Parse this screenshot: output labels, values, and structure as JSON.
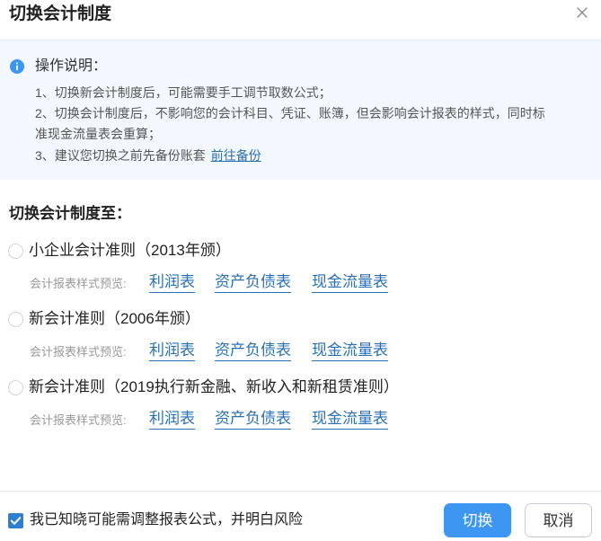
{
  "dialog": {
    "title": "切换会计制度"
  },
  "info": {
    "title": "操作说明：",
    "line1": "1、切换新会计制度后，可能需要手工调节取数公式；",
    "line2": "2、切换会计制度后，不影响您的会计科目、凭证、账簿，但会影响会计报表的样式，同时标",
    "line3": "准现金流量表会重算；",
    "line4_text": "3、建议您切换之前先备份账套",
    "line4_link": "前往备份"
  },
  "section": {
    "title": "切换会计制度至："
  },
  "options": [
    {
      "label": "小企业会计准则（2013年颁）",
      "preview_label": "会计报表样式预览:",
      "links": [
        "利润表",
        "资产负债表",
        "现金流量表"
      ]
    },
    {
      "label": "新会计准则（2006年颁）",
      "preview_label": "会计报表样式预览:",
      "links": [
        "利润表",
        "资产负债表",
        "现金流量表"
      ]
    },
    {
      "label": "新会计准则（2019执行新金融、新收入和新租赁准则）",
      "preview_label": "会计报表样式预览:",
      "links": [
        "利润表",
        "资产负债表",
        "现金流量表"
      ]
    }
  ],
  "footer": {
    "checkbox_label": "我已知晓可能需调整报表公式，并明白风险",
    "checkbox_checked": true,
    "confirm_label": "切换",
    "cancel_label": "取消"
  },
  "colors": {
    "primary": "#3d96f2",
    "link": "#2a6fb8",
    "info_bg": "#f2f8fd"
  },
  "icons": {
    "close": "close-icon",
    "info": "info-icon",
    "check": "check-icon"
  }
}
